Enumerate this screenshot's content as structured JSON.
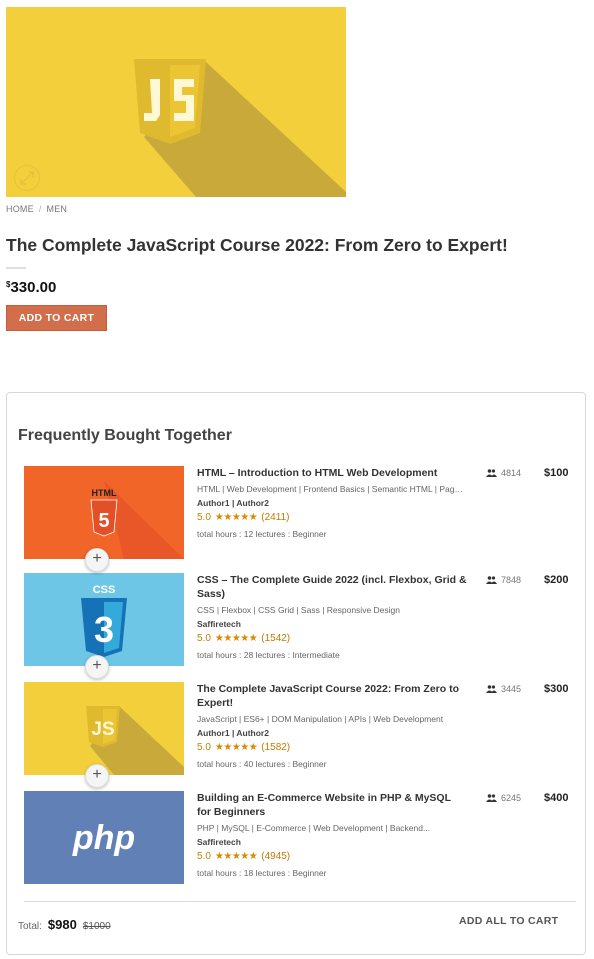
{
  "product": {
    "breadcrumb": [
      "HOME",
      "MEN"
    ],
    "title": "The Complete JavaScript Course 2022: From Zero to Expert!",
    "currency": "$",
    "price": "330.00",
    "add_to_cart": "ADD TO CART"
  },
  "fbt": {
    "heading": "Frequently Bought Together",
    "items": [
      {
        "title": "HTML – Introduction to HTML Web Development",
        "tags": "HTML | Web Development | Frontend Basics | Semantic HTML | Page...",
        "authors": "Author1 | Author2",
        "score": "5.0",
        "stars": "★★★★★",
        "reviews": "(2411)",
        "meta": "total hours : 12 lectures : Beginner",
        "students": "4814",
        "price": "$100"
      },
      {
        "title": "CSS – The Complete Guide 2022 (incl. Flexbox, Grid & Sass)",
        "tags": "CSS | Flexbox | CSS Grid | Sass | Responsive Design",
        "authors": "Saffiretech",
        "score": "5.0",
        "stars": "★★★★★",
        "reviews": "(1542)",
        "meta": "total hours : 28 lectures : Intermediate",
        "students": "7848",
        "price": "$200"
      },
      {
        "title": "The Complete JavaScript Course 2022: From Zero to Expert!",
        "tags": "JavaScript | ES6+ | DOM Manipulation | APIs | Web Development",
        "authors": "Author1 | Author2",
        "score": "5.0",
        "stars": "★★★★★",
        "reviews": "(1582)",
        "meta": "total hours : 40 lectures : Beginner",
        "students": "3445",
        "price": "$300"
      },
      {
        "title": "Building an E-Commerce Website in PHP & MySQL for Beginners",
        "tags": "PHP | MySQL | E-Commerce | Web Development | Backend...",
        "authors": "Saffiretech",
        "score": "5.0",
        "stars": "★★★★★",
        "reviews": "(4945)",
        "meta": "total hours : 18 lectures : Beginner",
        "students": "6245",
        "price": "$400"
      }
    ],
    "plus": "+",
    "total_label": "Total:",
    "total_now": "$980",
    "total_was": "$1000",
    "add_all": "ADD ALL TO CART",
    "logo_text": {
      "html": "HTML",
      "css": "CSS",
      "js": "JS",
      "php": "php"
    }
  },
  "colors": {
    "accent": "#d26e4b",
    "star": "#d98b00",
    "html_bg": "#f16529",
    "css_bg": "#6ec6e6",
    "js_bg": "#f4cf3c",
    "php_bg": "#6181b6"
  }
}
